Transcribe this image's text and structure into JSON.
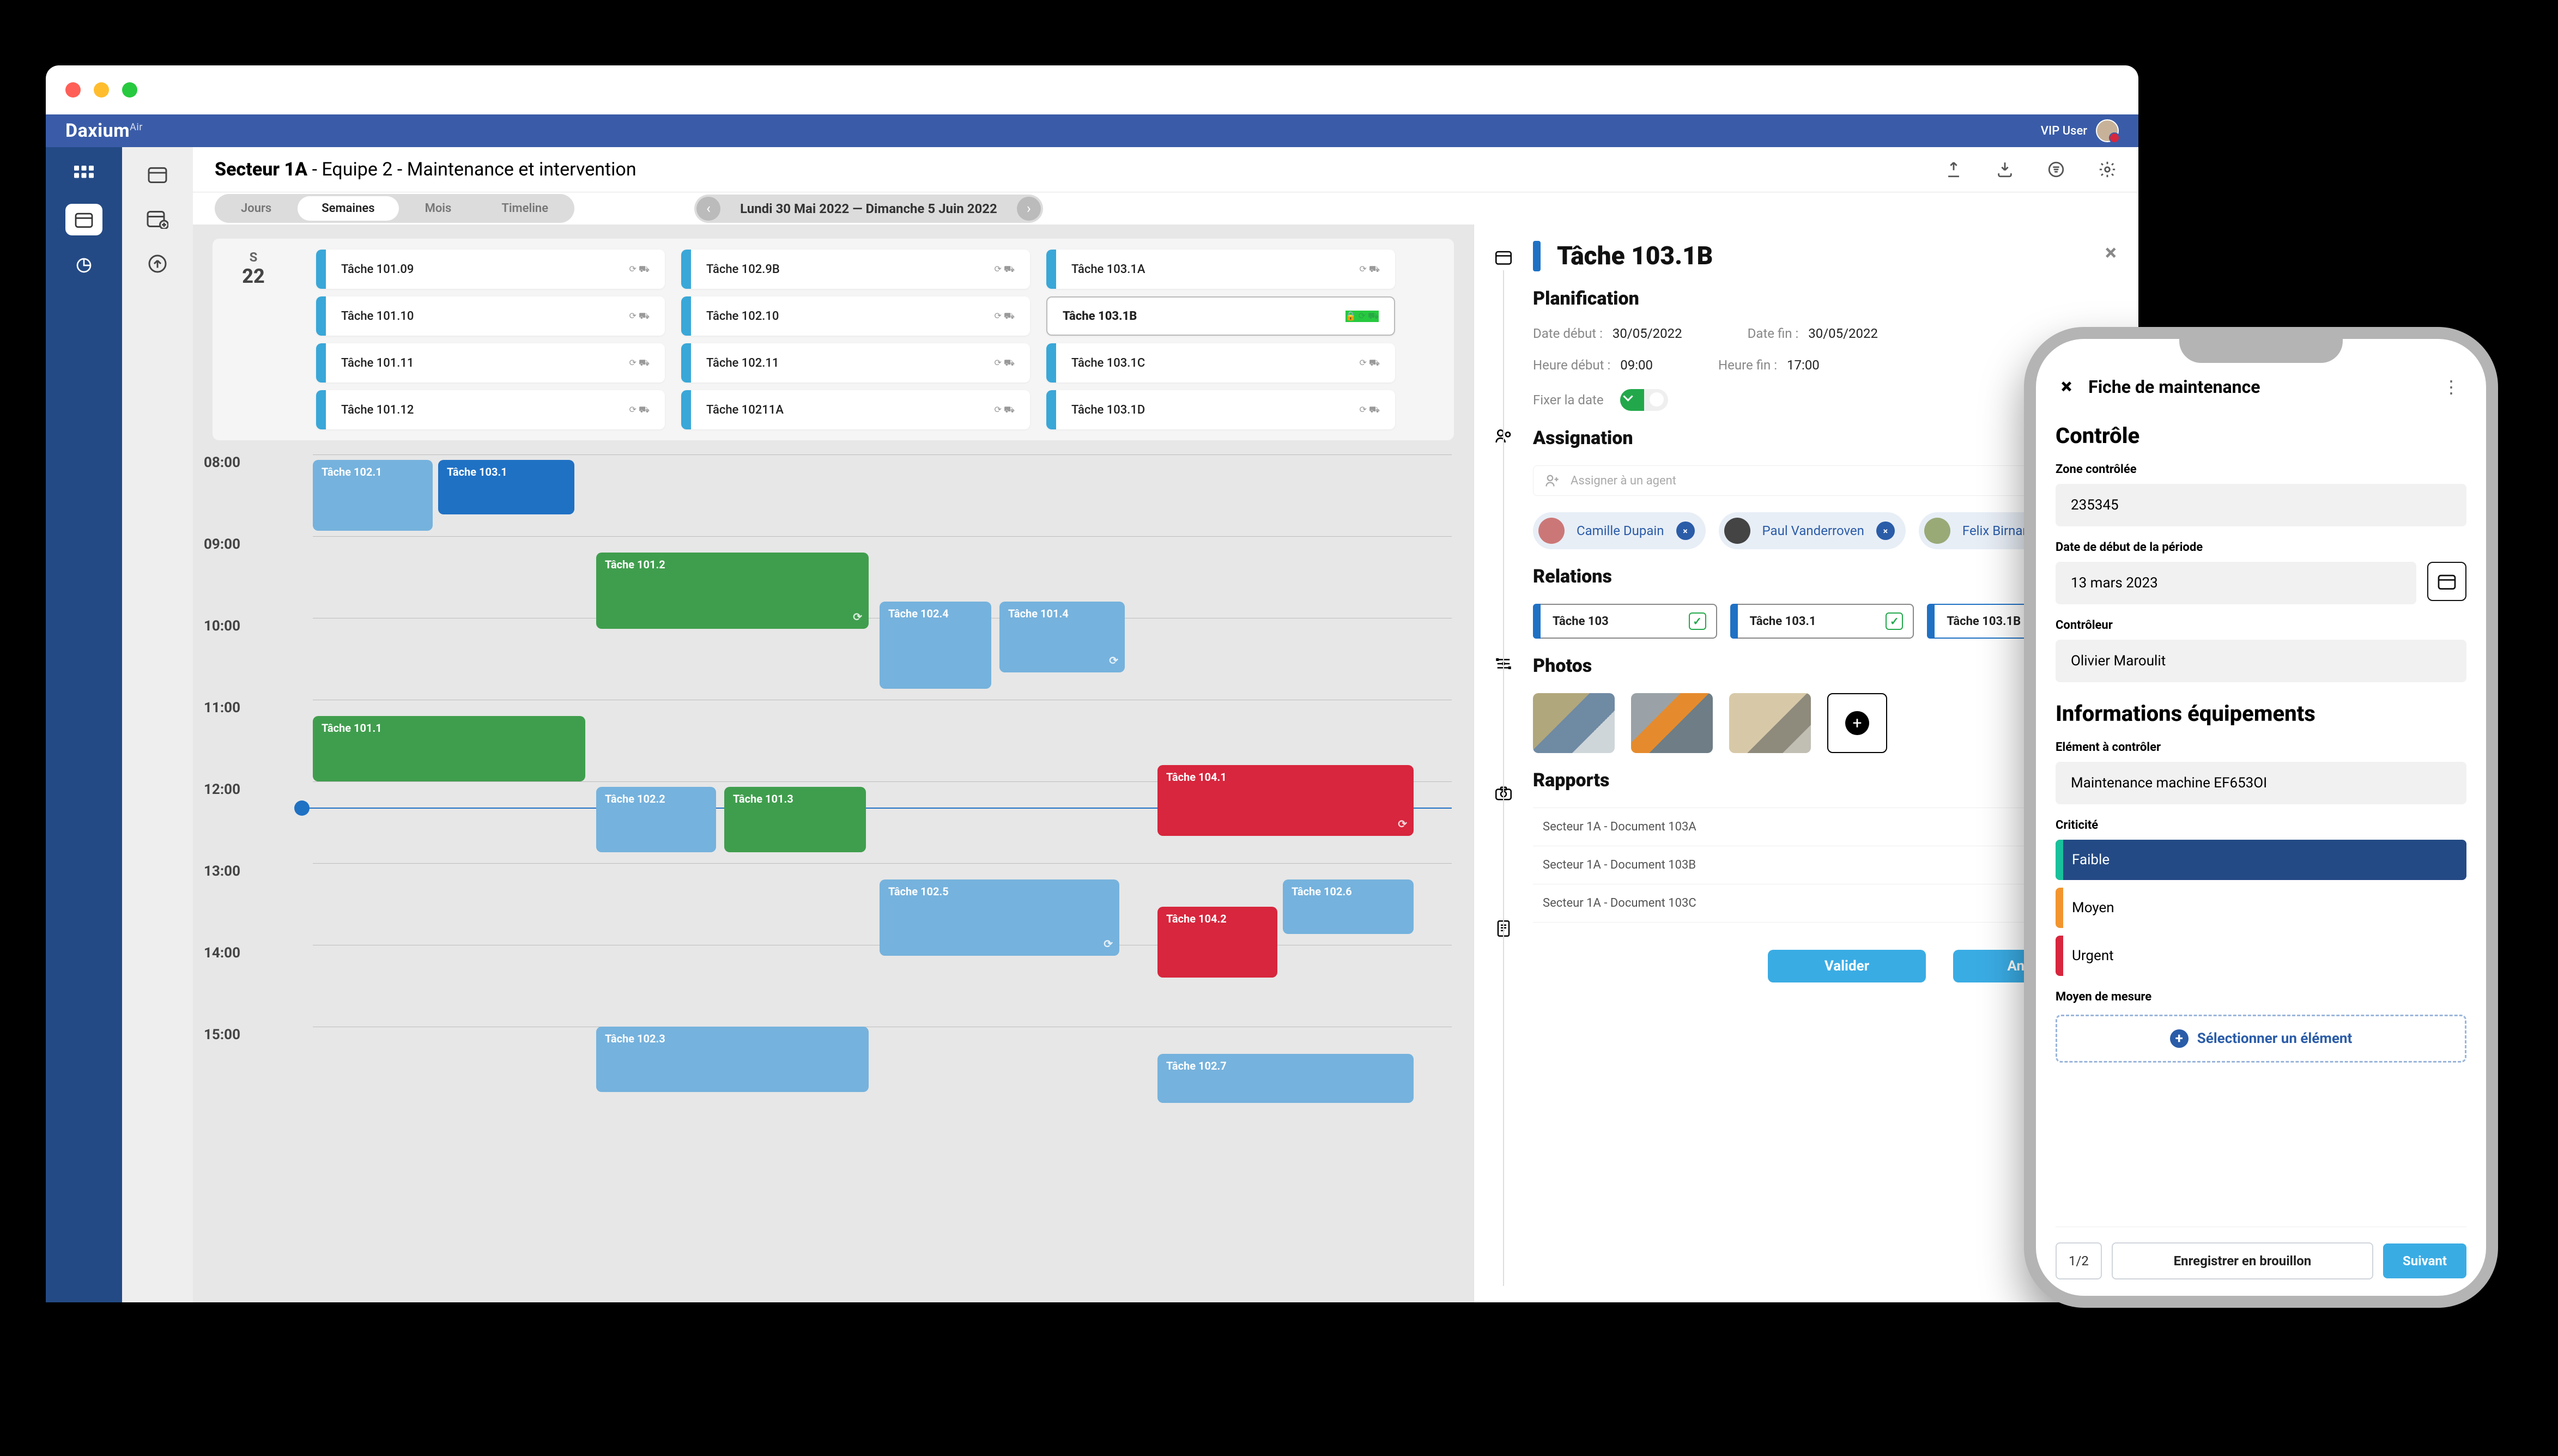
{
  "app": {
    "brand": "Daxium",
    "brand_suffix": "Air",
    "user_label": "VIP User"
  },
  "breadcrumb": {
    "sector": "Secteur 1A",
    "team": "Equipe 2",
    "context": "Maintenance et intervention"
  },
  "periods": {
    "days": "Jours",
    "weeks": "Semaines",
    "months": "Mois",
    "timeline": "Timeline"
  },
  "date_nav": {
    "range": "Lundi 30 Mai 2022 — Dimanche 5 Juin 2022"
  },
  "day_header": {
    "dow": "S",
    "dom": "22"
  },
  "unplanned": {
    "col1": [
      "Tâche 101.09",
      "Tâche 101.10",
      "Tâche 101.11",
      "Tâche 101.12"
    ],
    "col2": [
      "Tâche 102.9B",
      "Tâche 102.10",
      "Tâche 102.11",
      "Tâche 10211A"
    ],
    "col3": [
      "Tâche 103.1A",
      "Tâche 103.1B",
      "Tâche 103.1C",
      "Tâche 103.1D"
    ]
  },
  "hours": [
    "08:00",
    "09:00",
    "10:00",
    "11:00",
    "12:00",
    "13:00",
    "14:00",
    "15:00"
  ],
  "tasks": {
    "t1021": "Tâche 102.1",
    "t1031": "Tâche 103.1",
    "t1012": "Tâche 101.2",
    "t1024": "Tâche 102.4",
    "t1014": "Tâche 101.4",
    "t1011": "Tâche 101.1",
    "t1022": "Tâche 102.2",
    "t1013": "Tâche 101.3",
    "t1041": "Tâche 104.1",
    "t1025": "Tâche 102.5",
    "t1026": "Tâche 102.6",
    "t1042": "Tâche 104.2",
    "t1023": "Tâche 102.3",
    "t1027": "Tâche 102.7"
  },
  "detail": {
    "title": "Tâche 103.1B",
    "sections": {
      "planning": "Planification",
      "assign": "Assignation",
      "relations": "Relations",
      "photos": "Photos",
      "reports": "Rapports"
    },
    "planning": {
      "date_start_k": "Date début :",
      "date_start_v": "30/05/2022",
      "date_end_k": "Date fin :",
      "date_end_v": "30/05/2022",
      "time_start_k": "Heure début :",
      "time_start_v": "09:00",
      "time_end_k": "Heure fin :",
      "time_end_v": "17:00",
      "lock_label": "Fixer la date"
    },
    "assign": {
      "placeholder": "Assigner à un agent",
      "p1": "Camille Dupain",
      "p2": "Paul Vanderroven",
      "p3": "Felix Birnamm"
    },
    "relations": {
      "r1": "Tâche 103",
      "r2": "Tâche 103.1",
      "r3": "Tâche 103.1B"
    },
    "reports": {
      "r1": "Secteur 1A - Document 103A",
      "r2": "Secteur 1A - Document 103B",
      "r3": "Secteur 1A - Document 103C"
    },
    "actions": {
      "validate": "Valider",
      "cancel": "Annuler"
    }
  },
  "phone": {
    "header": "Fiche de maintenance",
    "section1": "Contrôle",
    "zone_label": "Zone contrôlée",
    "zone_value": "235345",
    "date_label": "Date de début de la période",
    "date_value": "13 mars 2023",
    "controller_label": "Contrôleur",
    "controller_value": "Olivier Maroulit",
    "section2": "Informations équipements",
    "element_label": "Elément à contrôler",
    "element_value": "Maintenance machine EF653OI",
    "crit_label": "Criticité",
    "crit_low": "Faible",
    "crit_mid": "Moyen",
    "crit_high": "Urgent",
    "measure_label": "Moyen de mesure",
    "select_label": "Sélectionner un élément",
    "footer": {
      "counter": "1/2",
      "draft": "Enregistrer en brouillon",
      "next": "Suivant"
    }
  }
}
